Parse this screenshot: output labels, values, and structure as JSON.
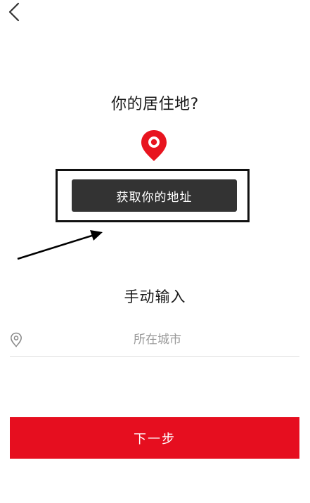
{
  "header": {
    "back_icon": "chevron-left-icon"
  },
  "title": "你的居住地?",
  "pin_icon": "location-pin-icon",
  "get_address_button": {
    "label": "获取你的地址"
  },
  "manual": {
    "heading": "手动输入",
    "city_field": {
      "icon": "location-outline-icon",
      "placeholder": "所在城市",
      "value": ""
    }
  },
  "next_button": {
    "label": "下一步"
  },
  "colors": {
    "accent_red": "#e60e1f",
    "dark_button": "#333333",
    "annotation": "#111111"
  }
}
